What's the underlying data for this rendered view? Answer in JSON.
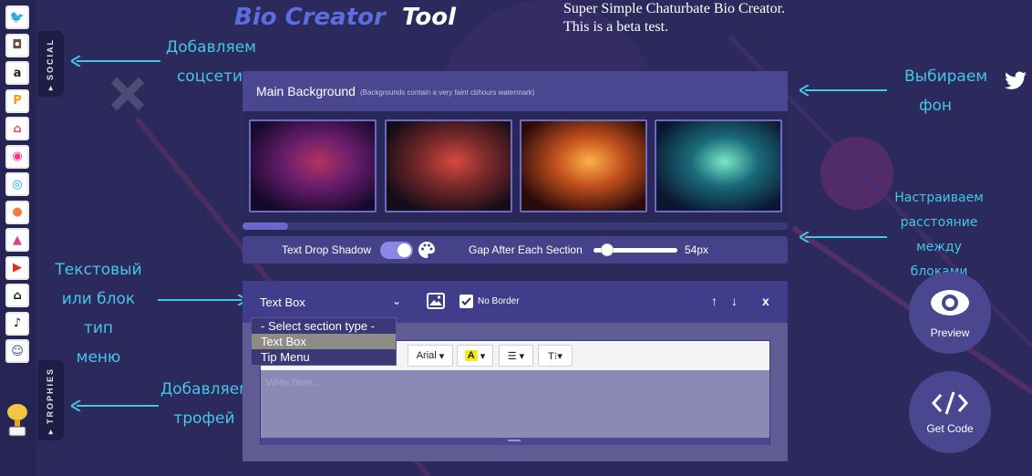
{
  "header": {
    "title_bio": "Bio Creator",
    "title_tool": "Tool",
    "tagline_line1": "Super Simple Chaturbate Bio Creator.",
    "tagline_line2": "This is a beta test."
  },
  "sidebar": {
    "social_tab": "▸ SOCIAL",
    "trophies_tab": "▸ TROPHIES",
    "icons": [
      {
        "name": "twitter-icon",
        "glyph": "🐦",
        "color": "#1da1f2"
      },
      {
        "name": "instagram-icon",
        "glyph": "◘",
        "color": "#6b4b3a"
      },
      {
        "name": "amazon-icon",
        "glyph": "a",
        "color": "#222222"
      },
      {
        "name": "pornhub-icon",
        "glyph": "P",
        "color": "#f7971d"
      },
      {
        "name": "pocket-icon",
        "glyph": "⌂",
        "color": "#ee4056"
      },
      {
        "name": "onlyfans-icon",
        "glyph": "◉",
        "color": "#ff2d83"
      },
      {
        "name": "onlyfans-lock-icon",
        "glyph": "◎",
        "color": "#00aff0"
      },
      {
        "name": "peach-icon",
        "glyph": "●",
        "color": "#ff7a3d"
      },
      {
        "name": "fansly-icon",
        "glyph": "▲",
        "color": "#e03c8a"
      },
      {
        "name": "youtube-icon",
        "glyph": "▶",
        "color": "#e52d27"
      },
      {
        "name": "home-icon",
        "glyph": "⌂",
        "color": "#111111"
      },
      {
        "name": "tiktok-icon",
        "glyph": "♪",
        "color": "#111111"
      },
      {
        "name": "avatar-icon",
        "glyph": "☺",
        "color": "#3b3b8a"
      }
    ],
    "trophy_caption": "TROPHY"
  },
  "annotations": {
    "add_socials": [
      "Добавляем",
      "соцсети"
    ],
    "choose_bg": [
      "Выбираем",
      "фон"
    ],
    "spacing": [
      "Настраиваем",
      "расстояние",
      "между",
      "блоками"
    ],
    "text_or_menu": [
      "Текстовый",
      "или блок тип",
      "меню"
    ],
    "add_trophy": [
      "Добавляем",
      "трофей"
    ]
  },
  "background_panel": {
    "title": "Main Background",
    "note": "(Backgrounds contain a very faint cbhours watermark)",
    "thumbnails": [
      {
        "name": "bg-thumb-purple",
        "c1": "#6b1e6e",
        "c2": "#b2345f",
        "c3": "#160a2c"
      },
      {
        "name": "bg-thumb-red",
        "c1": "#7a2a2a",
        "c2": "#d84a40",
        "c3": "#140c18"
      },
      {
        "name": "bg-thumb-orange",
        "c1": "#c2501c",
        "c2": "#ffb04a",
        "c3": "#2a0b0a"
      },
      {
        "name": "bg-thumb-teal",
        "c1": "#1a6a7a",
        "c2": "#7ae8c8",
        "c3": "#0b1630"
      }
    ]
  },
  "options": {
    "shadow_label": "Text Drop Shadow",
    "gap_label": "Gap After Each Section",
    "gap_value": "54px",
    "shadow_enabled": true
  },
  "section": {
    "type_value": "Text Box",
    "no_border_label": "No Border",
    "close_label": "x",
    "dropdown_options": [
      "- Select section type -",
      "Text Box",
      "Tip Menu"
    ],
    "font_select": "Arial",
    "placeholder": "Write here..."
  },
  "actions": {
    "preview_label": "Preview",
    "code_label": "Get Code"
  },
  "colors": {
    "accent": "#43c7e6",
    "background": "#2c2a5c",
    "panel": "#4a4790"
  }
}
